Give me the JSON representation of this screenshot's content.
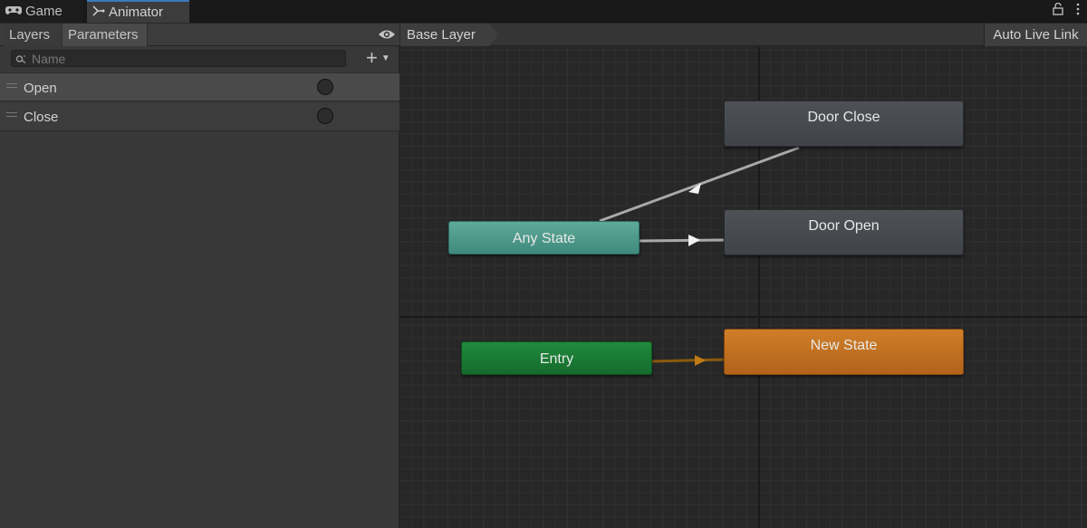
{
  "tabs": {
    "game": "Game",
    "animator": "Animator"
  },
  "left_panel": {
    "tabs": {
      "layers": "Layers",
      "parameters": "Parameters"
    },
    "search": {
      "placeholder": "Name",
      "value": ""
    },
    "add_label": "+",
    "parameters": [
      {
        "name": "Open",
        "type": "trigger"
      },
      {
        "name": "Close",
        "type": "trigger"
      }
    ]
  },
  "graph": {
    "breadcrumb": "Base Layer",
    "auto_live_link": "Auto Live Link",
    "states": {
      "any_state": "Any State",
      "entry": "Entry",
      "door_close": "Door Close",
      "door_open": "Door Open",
      "new_state": "New State"
    },
    "colors": {
      "any_state": "#4f9d8e",
      "entry": "#1a7a34",
      "default_state": "#d07e28",
      "state": "#474a4f",
      "transition": "#a9a9a9",
      "entry_transition": "#8a5a0e"
    }
  },
  "icons": {
    "game_tab": "gamepad-icon",
    "animator_tab": "animator-icon",
    "lock": "lock-icon",
    "menu": "kebab-menu-icon",
    "visibility": "eye-icon",
    "search": "search-icon",
    "add": "plus-icon"
  }
}
